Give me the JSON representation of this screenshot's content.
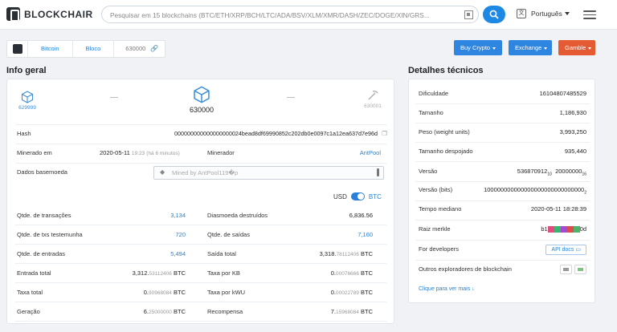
{
  "header": {
    "brand": "BLOCKCHAIR",
    "search_placeholder": "Pesquisar em 15 blockchains (BTC/ETH/XRP/BCH/LTC/ADA/BSV/XLM/XMR/DASH/ZEC/DOGE/XIN/GRS...",
    "language": "Português",
    "language_icon_glyph": "文"
  },
  "breadcrumb": {
    "items": [
      "Bitcoin",
      "Bloco"
    ],
    "current": "630000"
  },
  "buttons": {
    "buy_crypto": "Buy Crypto",
    "exchange": "Exchange",
    "gamble": "Gamble"
  },
  "colors": {
    "accent": "#1e88e5",
    "gamble": "#e45a33",
    "link": "#2683d6"
  },
  "info": {
    "title": "Info geral",
    "prev_block": "629999",
    "block": "630000",
    "next_block": "630001",
    "hash_label": "Hash",
    "hash": "000000000000000000024bead8df69990852c202db0e0097c1a12ea637d7e96d",
    "mined_label": "Minerado em",
    "mined_date": "2020-05-11",
    "mined_time": "19:23",
    "mined_ago": "(há 6 minutos)",
    "miner_label": "Minerador",
    "miner": "AntPool",
    "coinbase_label": "Dados basemoeda",
    "coinbase_value": "Mined by AntPool119�p",
    "currency_left": "USD",
    "currency_right": "BTC",
    "rows_left": [
      {
        "label": "Qtde. de transações",
        "value": "3,134",
        "link": true
      },
      {
        "label": "Qtde. de txs testemunha",
        "value": "720",
        "link": true
      },
      {
        "label": "Qtde. de entradas",
        "value": "5,494",
        "link": true
      },
      {
        "label": "Entrada total",
        "main": "3,312.",
        "dec": "53112406",
        "unit": "BTC"
      },
      {
        "label": "Taxa total",
        "main": "0.",
        "dec": "90968084",
        "unit": "BTC"
      },
      {
        "label": "Geração",
        "main": "6.",
        "dec": "25000000",
        "unit": "BTC"
      }
    ],
    "rows_right": [
      {
        "label": "Diasmoeda destruídos",
        "value": "6,836.56",
        "link": false
      },
      {
        "label": "Qtde. de saídas",
        "value": "7,160",
        "link": true
      },
      {
        "label": "Saída total",
        "main": "3,318.",
        "dec": "78112406",
        "unit": "BTC"
      },
      {
        "label": "Taxa por KB",
        "main": "0.",
        "dec": "00076666",
        "unit": "BTC"
      },
      {
        "label": "Taxa por kWU",
        "main": "0.",
        "dec": "00022789",
        "unit": "BTC"
      },
      {
        "label": "Recompensa",
        "main": "7.",
        "dec": "15968084",
        "unit": "BTC"
      }
    ]
  },
  "tech": {
    "title": "Detalhes técnicos",
    "rows": [
      {
        "label": "Dificuldade",
        "value": "16104807485529"
      },
      {
        "label": "Tamanho",
        "value": "1,186,930"
      },
      {
        "label": "Peso (weight units)",
        "value": "3,993,250"
      },
      {
        "label": "Tamanho despojado",
        "value": "935,440"
      }
    ],
    "version_label": "Versão",
    "version_dec": "536870912",
    "version_dec_base": "10",
    "version_hex": "20000000",
    "version_hex_base": "16",
    "version_bits_label": "Versão (bits)",
    "version_bits": "100000000000000000000000000000",
    "version_bits_base": "2",
    "median_label": "Tempo mediano",
    "median": "2020-05-11 18:28:39",
    "merkle_label": "Raiz merkle",
    "merkle_prefix": "b1",
    "merkle_suffix": "0d",
    "dev_label": "For developers",
    "api_docs": "API docs",
    "explorers_label": "Outros exploradores de blockchain",
    "more": "Clique para ver mais ↓"
  }
}
